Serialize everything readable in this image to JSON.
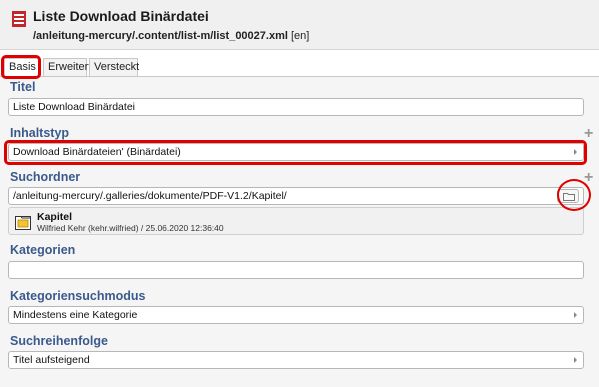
{
  "header": {
    "title": "Liste Download Binärdatei",
    "path": "/anleitung-mercury/.content/list-m/list_00027.xml",
    "locale": "[en]",
    "icon": "document-list-icon",
    "accent": "#c1272d"
  },
  "tabs": [
    {
      "label": "Basis",
      "active": true
    },
    {
      "label": "Erweitert",
      "active": false
    },
    {
      "label": "Versteckt",
      "active": false
    }
  ],
  "fields": {
    "titel": {
      "label": "Titel",
      "value": "Liste Download Binärdatei"
    },
    "inhaltstyp": {
      "label": "Inhaltstyp",
      "value": "Download Binärdateien' (Binärdatei)"
    },
    "suchordner": {
      "label": "Suchordner",
      "value": "/anleitung-mercury/.galleries/dokumente/PDF-V1.2/Kapitel/",
      "result_title": "Kapitel",
      "result_meta": "Wilfried Kehr (kehr.wilfried) / 25.06.2020 12:36:40"
    },
    "kategorien": {
      "label": "Kategorien",
      "value": ""
    },
    "kategoriensuchmodus": {
      "label": "Kategoriensuchmodus",
      "value": "Mindestens eine Kategorie"
    },
    "suchreihenfolge": {
      "label": "Suchreihenfolge",
      "value": "Titel aufsteigend"
    }
  },
  "colors": {
    "label_blue": "#3a5a8c",
    "highlight_red": "#e00000"
  }
}
